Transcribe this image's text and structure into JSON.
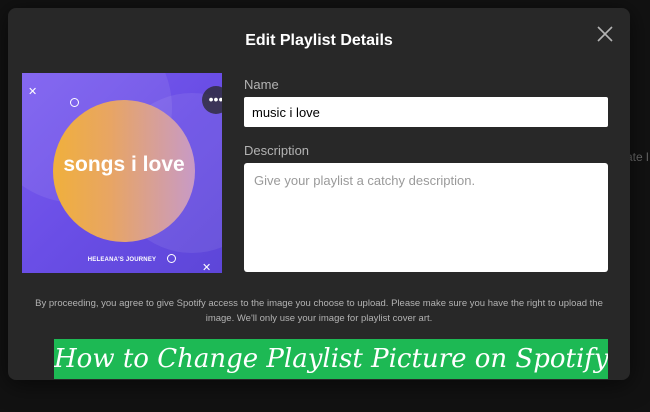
{
  "background": {
    "partial_text": "ate l"
  },
  "modal": {
    "title": "Edit Playlist Details",
    "close_icon": "close-icon"
  },
  "cover": {
    "title": "songs i love",
    "subtitle": "HELEANA'S JOURNEY",
    "more_icon": "more-options-icon",
    "more_glyph": "•••",
    "deco_x": "✕",
    "colors": {
      "gradient_start": "#7b5cf0",
      "circle_left": "#f0b03c",
      "circle_right": "#c89ac6"
    }
  },
  "form": {
    "name_label": "Name",
    "name_value": "music i love",
    "description_label": "Description",
    "description_placeholder": "Give your playlist a catchy description."
  },
  "disclaimer": "By proceeding, you agree to give Spotify access to the image you choose to upload. Please make sure you have the right to upload the image. We'll only use your image for playlist cover art.",
  "banner": {
    "text": "How to Change Playlist Picture on Spotify",
    "color": "#1db954"
  }
}
